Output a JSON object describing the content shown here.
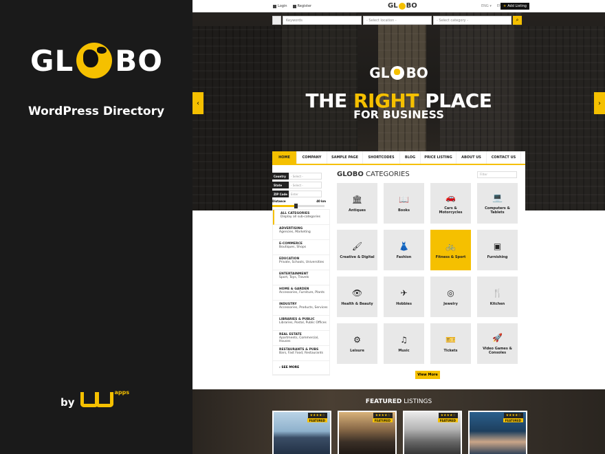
{
  "promo": {
    "logo_left": "GL",
    "logo_right": "BO",
    "tagline": "WordPress Directory",
    "by": "by",
    "brand_suffix": "apps"
  },
  "topbar": {
    "login": "Login",
    "register": "Register",
    "logo_left": "GL",
    "logo_right": "BO",
    "lang1": "ENG ▾",
    "lang2": "EN ▾",
    "add_listing": "Add Listing"
  },
  "search": {
    "keywords_placeholder": "Keywords",
    "location_placeholder": "- Select location -",
    "category_placeholder": "- Select category -"
  },
  "hero": {
    "logo_left": "GL",
    "logo_right": "BO",
    "title_1": "THE ",
    "title_highlight": "RIGHT",
    "title_2": " PLACE",
    "subtitle": "FOR BUSINESS",
    "prev": "‹",
    "next": "›"
  },
  "nav": {
    "items": [
      {
        "label": "HOME",
        "active": true
      },
      {
        "label": "COMPANY"
      },
      {
        "label": "SAMPLE PAGE"
      },
      {
        "label": "SHORTCODES"
      },
      {
        "label": "BLOG"
      },
      {
        "label": "PRICE LISTING"
      },
      {
        "label": "ABOUT US"
      },
      {
        "label": "CONTACT US"
      }
    ]
  },
  "filters": {
    "country_label": "Country",
    "country_value": "- Select -",
    "state_label": "State",
    "state_value": "- Select -",
    "zip_label": "ZIP Code",
    "zip_value": "Enter",
    "distance_label": "Distance",
    "distance_value": "40 km",
    "distance_fraction": 0.45
  },
  "categories_sidebar": [
    {
      "title": "ALL CATEGORIES",
      "sub": "Display all sub-categories"
    },
    {
      "title": "ADVERTISING",
      "sub": "Agencies, Marketing"
    },
    {
      "title": "E-COMMERCE",
      "sub": "Boutiques, Shops"
    },
    {
      "title": "EDUCATION",
      "sub": "Private, Schools, Universities"
    },
    {
      "title": "ENTERTAINMENT",
      "sub": "Sport, Toys, Travels"
    },
    {
      "title": "HOME & GARDEN",
      "sub": "Accessories, Furniture, Plants"
    },
    {
      "title": "INDUSTRY",
      "sub": "Accessories, Products, Services"
    },
    {
      "title": "LIBRARIES & PUBLIC",
      "sub": "Libraries, Postal, Public Offices"
    },
    {
      "title": "REAL ESTATE",
      "sub": "Apartments, Commercial, Houses"
    },
    {
      "title": "RESTAURANTS & PUBS",
      "sub": "Bars, Fast Food, Restaurants"
    }
  ],
  "see_more": "› SEE MORE",
  "categories_heading": {
    "bold": "GLOBO",
    "rest": " CATEGORIES"
  },
  "filter_placeholder": "Filter",
  "tiles": [
    {
      "name": "Antiques",
      "icon": "🏛",
      "icon_name": "bank-icon"
    },
    {
      "name": "Books",
      "icon": "📖",
      "icon_name": "book-icon"
    },
    {
      "name": "Cars & Motorcycles",
      "icon": "🚗",
      "icon_name": "car-icon"
    },
    {
      "name": "Computers & Tablets",
      "icon": "💻",
      "icon_name": "laptop-icon"
    },
    {
      "name": "Creative & Digital",
      "icon": "🖌",
      "icon_name": "brush-icon"
    },
    {
      "name": "Fashion",
      "icon": "👗",
      "icon_name": "dress-icon"
    },
    {
      "name": "Fitness & Sport",
      "icon": "🚲",
      "icon_name": "bicycle-icon",
      "highlight": true
    },
    {
      "name": "Furnishing",
      "icon": "▣",
      "icon_name": "cabinet-icon"
    },
    {
      "name": "Health & Beauty",
      "icon": "👁",
      "icon_name": "eye-icon"
    },
    {
      "name": "Hobbies",
      "icon": "✈",
      "icon_name": "paper-plane-icon"
    },
    {
      "name": "Jewelry",
      "icon": "◎",
      "icon_name": "gem-icon"
    },
    {
      "name": "Kitchen",
      "icon": "🍴",
      "icon_name": "cutlery-icon"
    },
    {
      "name": "Leisure",
      "icon": "⚙",
      "icon_name": "gear-icon"
    },
    {
      "name": "Music",
      "icon": "♫",
      "icon_name": "music-icon"
    },
    {
      "name": "Tickets",
      "icon": "🎫",
      "icon_name": "ticket-icon"
    },
    {
      "name": "Video Games & Consoles",
      "icon": "🚀",
      "icon_name": "rocket-icon"
    }
  ],
  "view_more": "View More",
  "featured": {
    "title_bold": "FEATURED",
    "title_rest": " LISTINGS",
    "cards": [
      {
        "rating": "★★★★☆",
        "label": "FEATURED"
      },
      {
        "rating": "★★★★☆",
        "label": "FEATURED"
      },
      {
        "rating": "★★★★☆",
        "label": "FEATURED"
      },
      {
        "rating": "★★★★☆",
        "label": "FEATURED"
      }
    ]
  }
}
